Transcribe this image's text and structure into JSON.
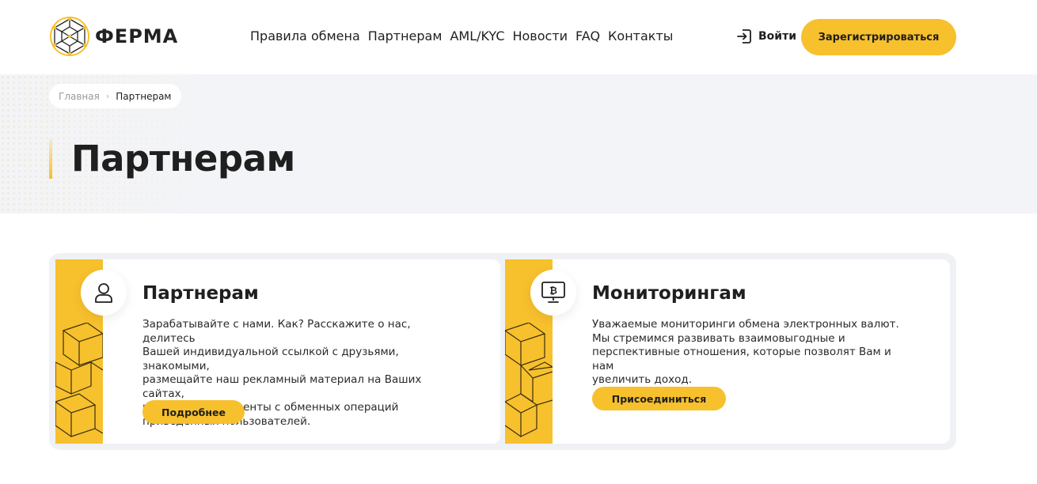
{
  "header": {
    "logo_text": "ФЕРМА",
    "nav": [
      "Правила обмена",
      "Партнерам",
      "AML/KYC",
      "Новости",
      "FAQ",
      "Контакты"
    ],
    "login_label": "Войти",
    "register_label": "Зарегистрироваться"
  },
  "hero": {
    "breadcrumb": {
      "home": "Главная",
      "separator": "›",
      "current": "Партнерам"
    },
    "title": "Партнерам"
  },
  "cards": [
    {
      "icon": "user-icon",
      "title": "Партнерам",
      "lines": [
        "Зарабатывайте с нами. Как? Расскажите о нас, делитесь",
        "Вашей индивидуальной ссылкой с друзьями, знакомыми,",
        "размещайте наш рекламный материал на Ваших сайтах,",
        "и получайте проценты с обменных операций",
        "приведённых пользователей."
      ],
      "button": "Подробнее"
    },
    {
      "icon": "bitcoin-monitor-icon",
      "title": "Мониторингам",
      "lines": [
        "Уважаемые мониторинги обмена электронных валют.",
        "Мы стремимся развивать взаимовыгодные и",
        "перспективные отношения, которые позволят Вам и нам",
        "увеличить доход."
      ],
      "button": "Присоединиться"
    }
  ],
  "colors": {
    "accent": "#f7c02d",
    "hero_bg": "#f3f4f7",
    "text": "#1f1f1f"
  }
}
